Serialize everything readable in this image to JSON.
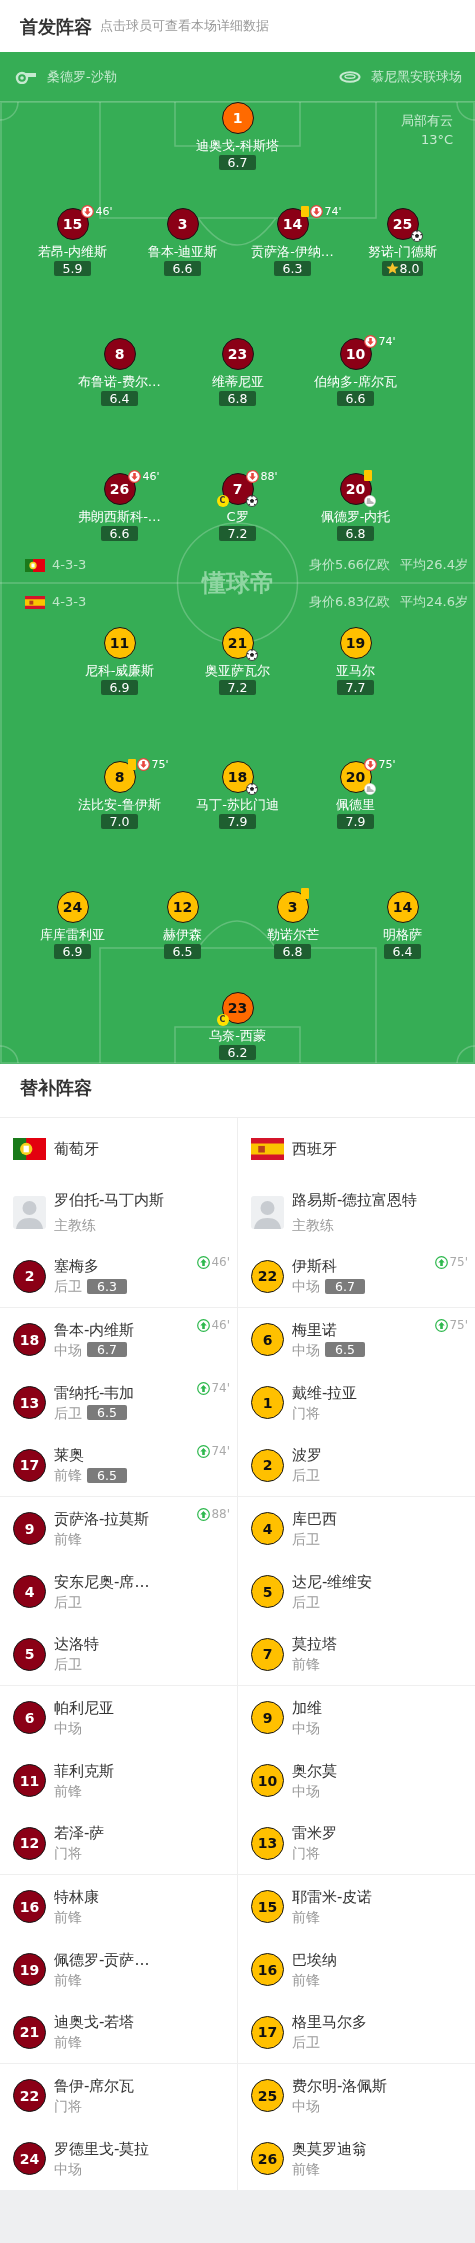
{
  "header": {
    "title": "首发阵容",
    "hint": "点击球员可查看本场详细数据"
  },
  "pitch": {
    "referee": "桑德罗-沙勒",
    "stadium": "慕尼黑安联球场",
    "weather": "局部有云",
    "temperature": "13°C",
    "logo": "懂球帝",
    "teams": [
      {
        "kind": "portugal",
        "formation": "4-3-3",
        "value": "身价5.66亿欧",
        "avg_age": "平均26.4岁",
        "color": "#8b0016",
        "lines": [
          {
            "color": "#ff6a00",
            "players": [
              {
                "number": "1",
                "name": "迪奥戈-科斯塔",
                "rating": "6.7",
                "best": false
              }
            ]
          },
          {
            "players": [
              {
                "number": "15",
                "name": "若昂-内维斯",
                "rating": "5.9",
                "best": false,
                "events": [
                  {
                    "kind": "sub_off",
                    "minute": "46'"
                  }
                ]
              },
              {
                "number": "3",
                "name": "鲁本-迪亚斯",
                "rating": "6.6",
                "best": false
              },
              {
                "number": "14",
                "name": "贡萨洛-伊纳…",
                "rating": "6.3",
                "best": false,
                "events": [
                  {
                    "kind": "yellow_card"
                  },
                  {
                    "kind": "sub_off",
                    "minute": "74'"
                  }
                ]
              },
              {
                "number": "25",
                "name": "努诺-门德斯",
                "rating": "8.0",
                "best": true,
                "events": [
                  {
                    "kind": "goal"
                  }
                ]
              }
            ]
          },
          {
            "players": [
              {
                "number": "8",
                "name": "布鲁诺-费尔…",
                "rating": "6.4",
                "best": false
              },
              {
                "number": "23",
                "name": "维蒂尼亚",
                "rating": "6.8",
                "best": false
              },
              {
                "number": "10",
                "name": "伯纳多-席尔瓦",
                "rating": "6.6",
                "best": false,
                "events": [
                  {
                    "kind": "sub_off",
                    "minute": "74'"
                  }
                ]
              }
            ]
          },
          {
            "players": [
              {
                "number": "26",
                "name": "弗朗西斯科-…",
                "rating": "6.6",
                "best": false,
                "events": [
                  {
                    "kind": "sub_off",
                    "minute": "46'"
                  }
                ]
              },
              {
                "number": "7",
                "name": "C罗",
                "rating": "7.2",
                "best": false,
                "captain_badge": "C",
                "events": [
                  {
                    "kind": "sub_off",
                    "minute": "88'"
                  },
                  {
                    "kind": "goal"
                  }
                ]
              },
              {
                "number": "20",
                "name": "佩德罗-内托",
                "rating": "6.8",
                "best": false,
                "events": [
                  {
                    "kind": "yellow_card"
                  },
                  {
                    "kind": "assist"
                  }
                ]
              }
            ]
          }
        ]
      },
      {
        "kind": "spain",
        "formation": "4-3-3",
        "value": "身价6.83亿欧",
        "avg_age": "平均24.6岁",
        "color": "#ffc000",
        "lines": [
          {
            "players": [
              {
                "number": "11",
                "name": "尼科-威廉斯",
                "rating": "6.9",
                "best": false
              },
              {
                "number": "21",
                "name": "奥亚萨瓦尔",
                "rating": "7.2",
                "best": false,
                "events": [
                  {
                    "kind": "goal"
                  }
                ]
              },
              {
                "number": "19",
                "name": "亚马尔",
                "rating": "7.7",
                "best": false
              }
            ]
          },
          {
            "players": [
              {
                "number": "8",
                "name": "法比安-鲁伊斯",
                "rating": "7.0",
                "best": false,
                "events": [
                  {
                    "kind": "yellow_card"
                  },
                  {
                    "kind": "sub_off",
                    "minute": "75'"
                  }
                ]
              },
              {
                "number": "18",
                "name": "马丁-苏比门迪",
                "rating": "7.9",
                "best": false,
                "events": [
                  {
                    "kind": "goal"
                  }
                ]
              },
              {
                "number": "20",
                "name": "佩德里",
                "rating": "7.9",
                "best": false,
                "events": [
                  {
                    "kind": "sub_off",
                    "minute": "75'"
                  },
                  {
                    "kind": "assist"
                  }
                ]
              }
            ]
          },
          {
            "players": [
              {
                "number": "24",
                "name": "库库雷利亚",
                "rating": "6.9",
                "best": false
              },
              {
                "number": "12",
                "name": "赫伊森",
                "rating": "6.5",
                "best": false
              },
              {
                "number": "3",
                "name": "勒诺尔芒",
                "rating": "6.8",
                "best": false,
                "events": [
                  {
                    "kind": "yellow_card"
                  }
                ]
              },
              {
                "number": "14",
                "name": "明格萨",
                "rating": "6.4",
                "best": false
              }
            ]
          },
          {
            "color": "#ff6a00",
            "players": [
              {
                "number": "23",
                "name": "乌奈-西蒙",
                "rating": "6.2",
                "best": false,
                "captain_badge": "C"
              }
            ]
          }
        ]
      }
    ]
  },
  "subs": {
    "title": "替补阵容",
    "teams": [
      {
        "name": "葡萄牙",
        "kind": "portugal",
        "color": "#8b0016",
        "coach": {
          "name": "罗伯托-马丁内斯",
          "role": "主教练"
        },
        "players": [
          {
            "number": "2",
            "name": "塞梅多",
            "position": "后卫",
            "rating": "6.3",
            "sub_in": "46'"
          },
          {
            "number": "18",
            "name": "鲁本-内维斯",
            "position": "中场",
            "rating": "6.7",
            "sub_in": "46'"
          },
          {
            "number": "13",
            "name": "雷纳托-韦加",
            "position": "后卫",
            "rating": "6.5",
            "sub_in": "74'"
          },
          {
            "number": "17",
            "name": "莱奥",
            "position": "前锋",
            "rating": "6.5",
            "sub_in": "74'"
          },
          {
            "number": "9",
            "name": "贡萨洛-拉莫斯",
            "position": "前锋",
            "sub_in": "88'"
          },
          {
            "number": "4",
            "name": "安东尼奥-席…",
            "position": "后卫"
          },
          {
            "number": "5",
            "name": "达洛特",
            "position": "后卫"
          },
          {
            "number": "6",
            "name": "帕利尼亚",
            "position": "中场"
          },
          {
            "number": "11",
            "name": "菲利克斯",
            "position": "前锋"
          },
          {
            "number": "12",
            "name": "若泽-萨",
            "position": "门将"
          },
          {
            "number": "16",
            "name": "特林康",
            "position": "前锋"
          },
          {
            "number": "19",
            "name": "佩德罗-贡萨…",
            "position": "前锋"
          },
          {
            "number": "21",
            "name": "迪奥戈-若塔",
            "position": "前锋"
          },
          {
            "number": "22",
            "name": "鲁伊-席尔瓦",
            "position": "门将"
          },
          {
            "number": "24",
            "name": "罗德里戈-莫拉",
            "position": "中场"
          }
        ]
      },
      {
        "name": "西班牙",
        "kind": "spain",
        "color": "#ffc000",
        "coach": {
          "name": "路易斯-德拉富恩特",
          "role": "主教练"
        },
        "players": [
          {
            "number": "22",
            "name": "伊斯科",
            "position": "中场",
            "rating": "6.7",
            "sub_in": "75'"
          },
          {
            "number": "6",
            "name": "梅里诺",
            "position": "中场",
            "rating": "6.5",
            "sub_in": "75'"
          },
          {
            "number": "1",
            "name": "戴维-拉亚",
            "position": "门将"
          },
          {
            "number": "2",
            "name": "波罗",
            "position": "后卫"
          },
          {
            "number": "4",
            "name": "库巴西",
            "position": "后卫"
          },
          {
            "number": "5",
            "name": "达尼-维维安",
            "position": "后卫"
          },
          {
            "number": "7",
            "name": "莫拉塔",
            "position": "前锋"
          },
          {
            "number": "9",
            "name": "加维",
            "position": "中场"
          },
          {
            "number": "10",
            "name": "奥尔莫",
            "position": "中场"
          },
          {
            "number": "13",
            "name": "雷米罗",
            "position": "门将"
          },
          {
            "number": "15",
            "name": "耶雷米-皮诺",
            "position": "前锋"
          },
          {
            "number": "16",
            "name": "巴埃纳",
            "position": "前锋"
          },
          {
            "number": "17",
            "name": "格里马尔多",
            "position": "后卫"
          },
          {
            "number": "25",
            "name": "费尔明-洛佩斯",
            "position": "中场"
          },
          {
            "number": "26",
            "name": "奥莫罗迪翁",
            "position": "前锋"
          }
        ]
      }
    ]
  }
}
